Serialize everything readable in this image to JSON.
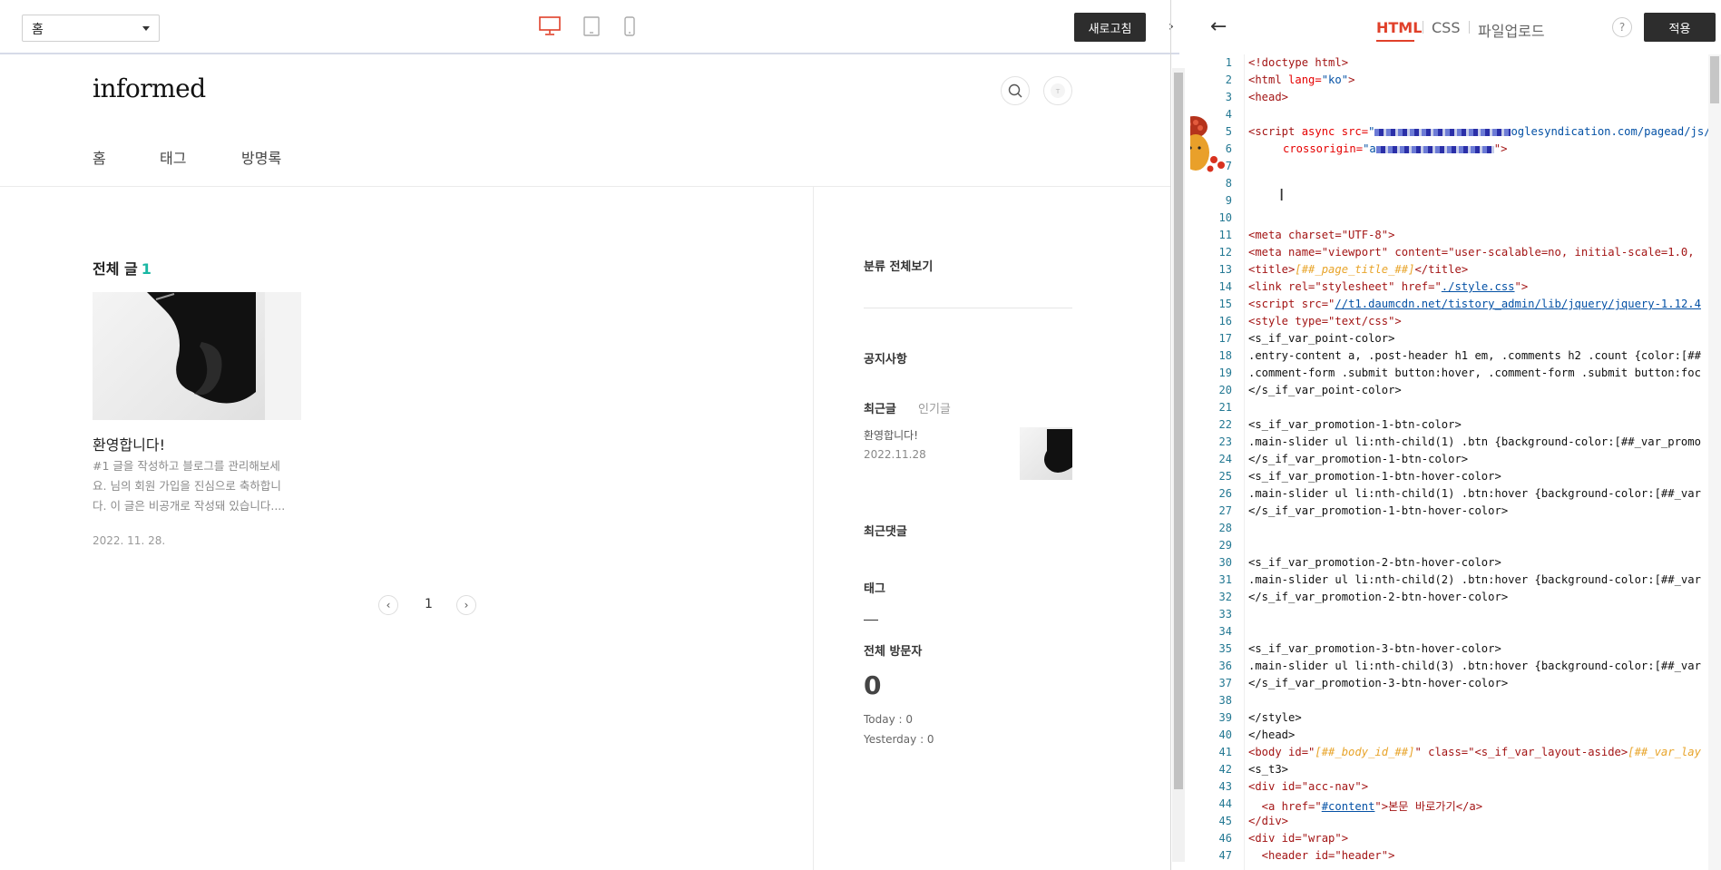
{
  "toolbar": {
    "page_select": "홈",
    "refresh_label": "새로고침",
    "collapse_glyph": "›"
  },
  "blog": {
    "logo": "informed",
    "nav": [
      "홈",
      "태그",
      "방명록"
    ],
    "section_title": "전체 글",
    "section_count": "1",
    "post": {
      "title": "환영합니다!",
      "excerpt": "#1 글을 작성하고 블로그를 관리해보세요. 님의 회원 가입을 진심으로 축하합니다. 이 글은 비공개로 작성돼 있습니다....",
      "date": "2022. 11. 28."
    },
    "pager": {
      "page": "1",
      "prev": "‹",
      "next": "›"
    }
  },
  "sidebar": {
    "category": "분류 전체보기",
    "notice": "공지사항",
    "recent_tab": "최근글",
    "popular_tab": "인기글",
    "recent_post_title": "환영합니다!",
    "recent_post_date": "2022.11.28",
    "recent_comments": "최근댓글",
    "tags": "태그",
    "visitors_title": "전체 방문자",
    "visitors_total": "0",
    "today": "Today : 0",
    "yesterday": "Yesterday : 0"
  },
  "editor": {
    "back_glyph": "←",
    "tabs": [
      "HTML",
      "CSS",
      "파일업로드"
    ],
    "help": "?",
    "apply_label": "적용",
    "lines": [
      "1",
      "2",
      "3",
      "4",
      "5",
      "6",
      "7",
      "8",
      "9",
      "10",
      "11",
      "12",
      "13",
      "14",
      "15",
      "16",
      "17",
      "18",
      "19",
      "20",
      "21",
      "22",
      "23",
      "24",
      "25",
      "26",
      "27",
      "28",
      "29",
      "30",
      "31",
      "32",
      "33",
      "34",
      "35",
      "36",
      "37",
      "38",
      "39",
      "40",
      "41",
      "42",
      "43",
      "44",
      "45",
      "46",
      "47"
    ],
    "code": {
      "l1": "<!doctype html>",
      "l2_tag": "<html",
      "l2_attr": " lang=",
      "l2_val": "\"ko\"",
      "l2_end": ">",
      "l3": "<head>",
      "l5_a": "<script",
      "l5_b": " async src=",
      "l5_c": "\"",
      "l5_d": "oglesyndication.com/pagead/js/a",
      "l6_a": "crossorigin=",
      "l6_b": "\"a",
      "l6_c": "\">",
      "l11": "<meta charset=\"UTF-8\">",
      "l12": "<meta name=\"viewport\" content=\"user-scalable=no, initial-scale=1.0,",
      "l13_a": "<title>",
      "l13_b": "[##_page_title_##]",
      "l13_c": "</title>",
      "l14_a": "<link rel=\"stylesheet\" href=\"",
      "l14_b": "./style.css",
      "l14_c": "\">",
      "l15_a": "<script src=\"",
      "l15_b": "//t1.daumcdn.net/tistory_admin/lib/jquery/jquery-1.12.4",
      "l16": "<style type=\"text/css\">",
      "l17": "<s_if_var_point-color>",
      "l18": ".entry-content a, .post-header h1 em, .comments h2 .count {color:[##",
      "l19": ".comment-form .submit button:hover, .comment-form .submit button:foc",
      "l20": "</s_if_var_point-color>",
      "l22": "<s_if_var_promotion-1-btn-color>",
      "l23": ".main-slider ul li:nth-child(1) .btn {background-color:[##_var_promo",
      "l24": "</s_if_var_promotion-1-btn-color>",
      "l25": "<s_if_var_promotion-1-btn-hover-color>",
      "l26": ".main-slider ul li:nth-child(1) .btn:hover {background-color:[##_var",
      "l27": "</s_if_var_promotion-1-btn-hover-color>",
      "l30": "<s_if_var_promotion-2-btn-hover-color>",
      "l31": ".main-slider ul li:nth-child(2) .btn:hover {background-color:[##_var",
      "l32": "</s_if_var_promotion-2-btn-hover-color>",
      "l35": "<s_if_var_promotion-3-btn-hover-color>",
      "l36": ".main-slider ul li:nth-child(3) .btn:hover {background-color:[##_var",
      "l37": "</s_if_var_promotion-3-btn-hover-color>",
      "l39": "</style>",
      "l40": "</head>",
      "l41_a": "<body id=\"",
      "l41_b": "[##_body_id_##]",
      "l41_c": "\" class=\"<s_if_var_layout-aside>",
      "l41_d": "[##_var_lay",
      "l42": "<s_t3>",
      "l43": "<div id=\"acc-nav\">",
      "l44_a": "  <a href=\"",
      "l44_b": "#content",
      "l44_c": "\">본문 바로가기</a>",
      "l45": "</div>",
      "l46": "<div id=\"wrap\">",
      "l47": "  <header id=\"header\">"
    }
  },
  "colors": {
    "accent": "#e0402a",
    "count_teal": "#19b7a3",
    "button_dark": "#2d2d2d"
  }
}
